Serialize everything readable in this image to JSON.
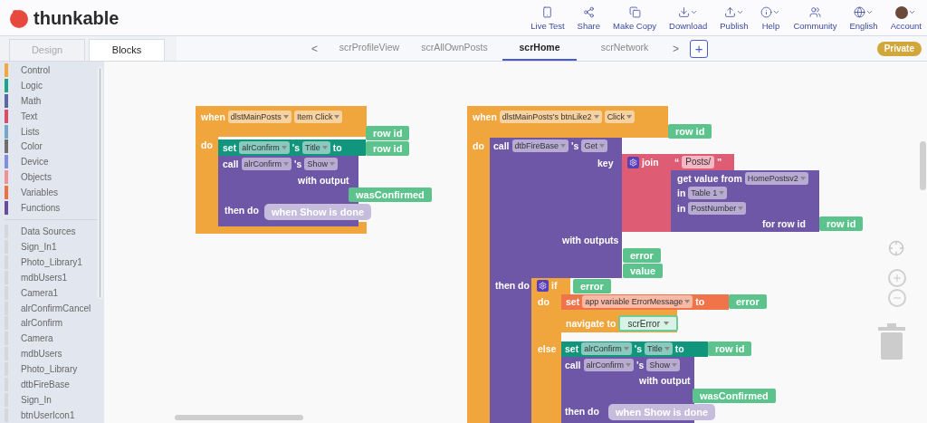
{
  "app": {
    "name": "thunkable"
  },
  "nav": [
    {
      "label": "Live Test",
      "menu": false
    },
    {
      "label": "Share",
      "menu": false
    },
    {
      "label": "Make Copy",
      "menu": false
    },
    {
      "label": "Download",
      "menu": true
    },
    {
      "label": "Publish",
      "menu": true
    },
    {
      "label": "Help",
      "menu": true
    },
    {
      "label": "Community",
      "menu": false
    },
    {
      "label": "English",
      "menu": true
    },
    {
      "label": "Account",
      "menu": true
    }
  ],
  "editor_tabs": [
    {
      "label": "Design",
      "selected": false
    },
    {
      "label": "Blocks",
      "selected": true
    }
  ],
  "screen_tabs": {
    "prev": "<",
    "next": ">",
    "add": "+",
    "items": [
      {
        "label": "scrProfileView",
        "selected": false
      },
      {
        "label": "scrAllOwnPosts",
        "selected": false
      },
      {
        "label": "scrHome",
        "selected": true
      },
      {
        "label": "scrNetwork",
        "selected": false
      }
    ]
  },
  "badge": "Private",
  "palette": {
    "categories": [
      {
        "label": "Control",
        "color": "#f3a83b"
      },
      {
        "label": "Logic",
        "color": "#1aa58a"
      },
      {
        "label": "Math",
        "color": "#5b67a5"
      },
      {
        "label": "Text",
        "color": "#dd4b6a"
      },
      {
        "label": "Lists",
        "color": "#74a8c8"
      },
      {
        "label": "Color",
        "color": "#6e6e6e"
      },
      {
        "label": "Device",
        "color": "#7d8ee0"
      },
      {
        "label": "Objects",
        "color": "#f29093"
      },
      {
        "label": "Variables",
        "color": "#f0703f"
      },
      {
        "label": "Functions",
        "color": "#6a4a9e"
      }
    ],
    "components": [
      "Data Sources",
      "Sign_In1",
      "Photo_Library1",
      "mdbUsers1",
      "Camera1",
      "alrConfirmCancel",
      "alrConfirm",
      "Camera",
      "mdbUsers",
      "Photo_Library",
      "dtbFireBase",
      "Sign_In",
      "btnUserIcon1"
    ]
  },
  "scripts": [
    {
      "rows": [
        {
          "pieces": [
            {
              "kind": "label",
              "text": "when"
            },
            {
              "kind": "dropdown",
              "text": "dlstMainPosts"
            },
            {
              "kind": "dropdown",
              "text": "Item Click"
            }
          ]
        },
        {
          "pieces": [
            {
              "kind": "output",
              "text": "row id"
            }
          ]
        },
        {
          "pieces": [
            {
              "kind": "label",
              "text": "do"
            }
          ]
        },
        {
          "pieces": [
            {
              "kind": "label",
              "text": "set"
            },
            {
              "kind": "dropdown",
              "text": "alrConfirm"
            },
            {
              "kind": "label",
              "text": "'s"
            },
            {
              "kind": "dropdown",
              "text": "Title"
            },
            {
              "kind": "label",
              "text": "to"
            }
          ]
        },
        {
          "pieces": [
            {
              "kind": "output",
              "text": "row id"
            }
          ]
        },
        {
          "pieces": [
            {
              "kind": "label",
              "text": "call"
            },
            {
              "kind": "dropdown",
              "text": "alrConfirm"
            },
            {
              "kind": "label",
              "text": "'s"
            },
            {
              "kind": "dropdown",
              "text": "Show"
            }
          ]
        },
        {
          "pieces": [
            {
              "kind": "label",
              "text": "with output"
            }
          ]
        },
        {
          "pieces": [
            {
              "kind": "output",
              "text": "wasConfirmed"
            }
          ]
        },
        {
          "pieces": [
            {
              "kind": "label",
              "text": "then do"
            }
          ]
        },
        {
          "pieces": [
            {
              "kind": "handler",
              "text": "when Show is done"
            }
          ]
        }
      ]
    },
    {
      "rows": [
        {
          "pieces": [
            {
              "kind": "label",
              "text": "when"
            },
            {
              "kind": "dropdown",
              "text": "dlstMainPosts's btnLike2"
            },
            {
              "kind": "dropdown",
              "text": "Click"
            }
          ]
        },
        {
          "pieces": [
            {
              "kind": "output",
              "text": "row id"
            }
          ]
        },
        {
          "pieces": [
            {
              "kind": "label",
              "text": "do"
            }
          ]
        },
        {
          "pieces": [
            {
              "kind": "label",
              "text": "call"
            },
            {
              "kind": "dropdown",
              "text": "dtbFireBase"
            },
            {
              "kind": "label",
              "text": "'s"
            },
            {
              "kind": "dropdown",
              "text": "Get"
            }
          ]
        },
        {
          "pieces": [
            {
              "kind": "label",
              "text": "key"
            }
          ]
        },
        {
          "pieces": [
            {
              "kind": "mutator"
            },
            {
              "kind": "label",
              "text": "join"
            }
          ]
        },
        {
          "pieces": [
            {
              "kind": "label",
              "text": "“"
            },
            {
              "kind": "field",
              "text": "Posts/"
            },
            {
              "kind": "label",
              "text": "”"
            }
          ]
        },
        {
          "pieces": [
            {
              "kind": "label",
              "text": "get value from"
            },
            {
              "kind": "dropdown",
              "text": "HomePostsv2"
            }
          ]
        },
        {
          "pieces": [
            {
              "kind": "label",
              "text": "in"
            },
            {
              "kind": "dropdown",
              "text": "Table 1"
            }
          ]
        },
        {
          "pieces": [
            {
              "kind": "label",
              "text": "in"
            },
            {
              "kind": "dropdown",
              "text": "PostNumber"
            }
          ]
        },
        {
          "pieces": [
            {
              "kind": "label",
              "text": "for row id"
            }
          ]
        },
        {
          "pieces": [
            {
              "kind": "output",
              "text": "row id"
            }
          ]
        },
        {
          "pieces": [
            {
              "kind": "label",
              "text": "with outputs"
            }
          ]
        },
        {
          "pieces": [
            {
              "kind": "output",
              "text": "error"
            }
          ]
        },
        {
          "pieces": [
            {
              "kind": "output",
              "text": "value"
            }
          ]
        },
        {
          "pieces": [
            {
              "kind": "label",
              "text": "then do"
            }
          ]
        },
        {
          "pieces": [
            {
              "kind": "mutator"
            },
            {
              "kind": "label",
              "text": "if"
            }
          ]
        },
        {
          "pieces": [
            {
              "kind": "output",
              "text": "error"
            }
          ]
        },
        {
          "pieces": [
            {
              "kind": "label",
              "text": "do"
            }
          ]
        },
        {
          "pieces": [
            {
              "kind": "label",
              "text": "set"
            },
            {
              "kind": "dropdown",
              "text": "app variable ErrorMessage"
            },
            {
              "kind": "label",
              "text": "to"
            }
          ]
        },
        {
          "pieces": [
            {
              "kind": "output",
              "text": "error"
            }
          ]
        },
        {
          "pieces": [
            {
              "kind": "label",
              "text": "navigate to"
            },
            {
              "kind": "screen-dropdown",
              "text": "scrError"
            }
          ]
        },
        {
          "pieces": [
            {
              "kind": "label",
              "text": "else"
            }
          ]
        },
        {
          "pieces": [
            {
              "kind": "label",
              "text": "set"
            },
            {
              "kind": "dropdown",
              "text": "alrConfirm"
            },
            {
              "kind": "label",
              "text": "'s"
            },
            {
              "kind": "dropdown",
              "text": "Title"
            },
            {
              "kind": "label",
              "text": "to"
            }
          ]
        },
        {
          "pieces": [
            {
              "kind": "output",
              "text": "row id"
            }
          ]
        },
        {
          "pieces": [
            {
              "kind": "label",
              "text": "call"
            },
            {
              "kind": "dropdown",
              "text": "alrConfirm"
            },
            {
              "kind": "label",
              "text": "'s"
            },
            {
              "kind": "dropdown",
              "text": "Show"
            }
          ]
        },
        {
          "pieces": [
            {
              "kind": "label",
              "text": "with output"
            }
          ]
        },
        {
          "pieces": [
            {
              "kind": "output",
              "text": "wasConfirmed"
            }
          ]
        },
        {
          "pieces": [
            {
              "kind": "label",
              "text": "then do"
            }
          ]
        },
        {
          "pieces": [
            {
              "kind": "handler",
              "text": "when Show is done"
            }
          ]
        }
      ]
    }
  ]
}
